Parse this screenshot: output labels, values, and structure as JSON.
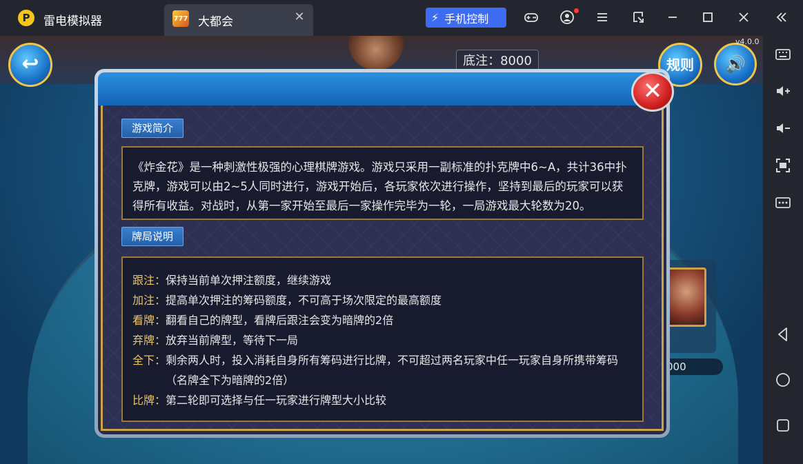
{
  "titlebar": {
    "logo_glyph": "P",
    "app_name": "雷电模拟器",
    "tab": {
      "icon_text": "777",
      "title": "大都会",
      "close_glyph": "✕"
    },
    "phone_control_label": "手机控制",
    "icons": [
      "gamepad-icon",
      "user-icon",
      "menu-icon",
      "window-shrink-icon",
      "minimize-icon",
      "maximize-icon",
      "close-icon",
      "collapse-sidebar-icon"
    ]
  },
  "sidebar": {
    "icons": [
      "keyboard-icon",
      "volume-up-icon",
      "volume-down-icon",
      "screenshot-icon",
      "more-icon",
      "back-nav-icon",
      "home-nav-icon",
      "recents-nav-icon"
    ]
  },
  "game": {
    "bet_label": "底注：8000",
    "rules_label": "规则",
    "version": "v4.0.0",
    "player_chips_partial": "000"
  },
  "dialog": {
    "intro_tag": "游戏简介",
    "intro_text": "《炸金花》是一种刺激性极强的心理棋牌游戏。游戏只采用一副标准的扑克牌中6~A，共计36中扑克牌，游戏可以由2~5人同时进行，游戏开始后，各玩家依次进行操作，坚持到最后的玩家可以获得所有收益。对战时，从第一家开始至最后一家操作完毕为一轮，一局游戏最大轮数为20。",
    "rules_tag": "牌局说明",
    "rules": [
      {
        "key": "跟注：",
        "text": "保持当前单次押注额度，继续游戏"
      },
      {
        "key": "加注：",
        "text": "提高单次押注的筹码额度，不可高于场次限定的最高额度"
      },
      {
        "key": "看牌：",
        "text": "翻看自己的牌型，看牌后跟注会变为暗牌的2倍"
      },
      {
        "key": "弃牌：",
        "text": "放弃当前牌型，等待下一局"
      },
      {
        "key": "全下：",
        "text": "剩余两人时，投入消耗自身所有筹码进行比牌，不可超过两名玩家中任一玩家自身所携带筹码（名牌全下为暗牌的2倍）"
      },
      {
        "key": "比牌：",
        "text": "第二轮即可选择与任一玩家进行牌型大小比较"
      }
    ]
  }
}
